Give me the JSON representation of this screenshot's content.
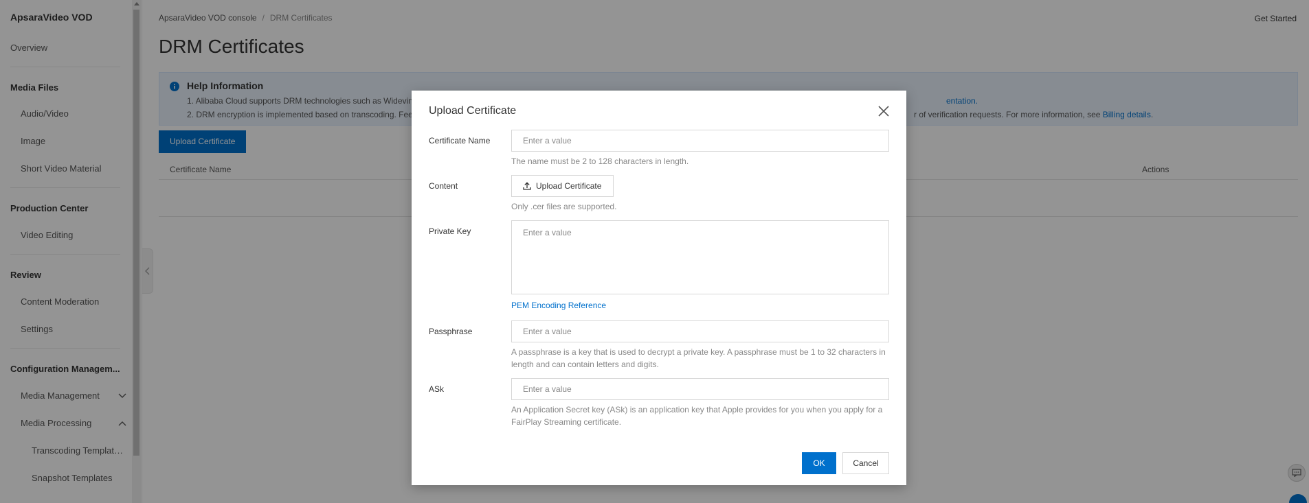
{
  "sidebar": {
    "title": "ApsaraVideo VOD",
    "overview": "Overview",
    "media_files": {
      "label": "Media Files",
      "items": [
        "Audio/Video",
        "Image",
        "Short Video Material"
      ]
    },
    "production_center": {
      "label": "Production Center",
      "items": [
        "Video Editing"
      ]
    },
    "review": {
      "label": "Review",
      "items": [
        "Content Moderation",
        "Settings"
      ]
    },
    "configuration": {
      "label": "Configuration Managem...",
      "media_management": "Media Management",
      "media_processing": "Media Processing",
      "sub_items": [
        "Transcoding Template ...",
        "Snapshot Templates"
      ]
    }
  },
  "breadcrumb": {
    "root": "ApsaraVideo VOD console",
    "separator": "/",
    "current": "DRM Certificates"
  },
  "header": {
    "get_started": "Get Started",
    "page_title": "DRM Certificates"
  },
  "help": {
    "title": "Help Information",
    "line1_start": "1. Alibaba Cloud supports DRM technologies such as Widevine",
    "line1_link_tail": "entation.",
    "line2_start": "2. DRM encryption is implemented based on transcoding. Fees",
    "line2_end": "r of verification requests. For more information, see",
    "line2_link": "Billing details",
    "line2_period": "."
  },
  "toolbar": {
    "upload_label": "Upload Certificate"
  },
  "table": {
    "columns": [
      "Certificate Name",
      "Actions"
    ]
  },
  "dialog": {
    "title": "Upload Certificate",
    "fields": {
      "name": {
        "label": "Certificate Name",
        "placeholder": "Enter a value",
        "help": "The name must be 2 to 128 characters in length."
      },
      "content": {
        "label": "Content",
        "button": "Upload Certificate",
        "help": "Only .cer files are supported."
      },
      "private_key": {
        "label": "Private Key",
        "placeholder": "Enter a value",
        "link": "PEM Encoding Reference"
      },
      "passphrase": {
        "label": "Passphrase",
        "placeholder": "Enter a value",
        "help": "A passphrase is a key that is used to decrypt a private key. A passphrase must be 1 to 32 characters in length and can contain letters and digits."
      },
      "ask": {
        "label": "ASk",
        "placeholder": "Enter a value",
        "help": "An Application Secret key (ASk) is an application key that Apple provides for you when you apply for a FairPlay Streaming certificate."
      }
    },
    "ok_label": "OK",
    "cancel_label": "Cancel"
  },
  "colors": {
    "primary": "#0070cc",
    "help_bg": "#e9f2fc"
  }
}
